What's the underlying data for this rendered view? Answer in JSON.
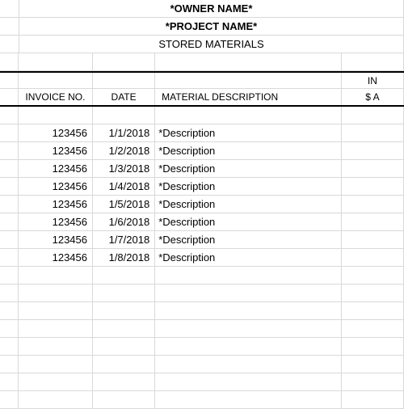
{
  "header": {
    "owner_name": "*OWNER NAME*",
    "project_name": "*PROJECT NAME*",
    "subtitle": "STORED MATERIALS"
  },
  "columns": {
    "invoice_no": "INVOICE NO.",
    "date": "DATE",
    "material_description": "MATERIAL DESCRIPTION",
    "inv_top": "IN",
    "inv_amount": "$ A"
  },
  "rows": [
    {
      "invoice": "123456",
      "date": "1/1/2018",
      "desc": "*Description"
    },
    {
      "invoice": "123456",
      "date": "1/2/2018",
      "desc": "*Description"
    },
    {
      "invoice": "123456",
      "date": "1/3/2018",
      "desc": "*Description"
    },
    {
      "invoice": "123456",
      "date": "1/4/2018",
      "desc": "*Description"
    },
    {
      "invoice": "123456",
      "date": "1/5/2018",
      "desc": "*Description"
    },
    {
      "invoice": "123456",
      "date": "1/6/2018",
      "desc": "*Description"
    },
    {
      "invoice": "123456",
      "date": "1/7/2018",
      "desc": "*Description"
    },
    {
      "invoice": "123456",
      "date": "1/8/2018",
      "desc": "*Description"
    }
  ]
}
